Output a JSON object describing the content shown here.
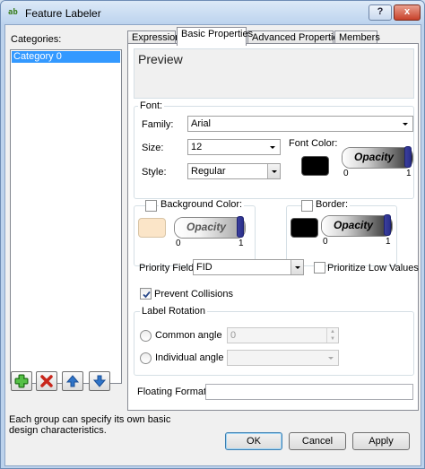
{
  "window": {
    "title": "Feature Labeler",
    "icon": "labeler-icon"
  },
  "titlebar": {
    "help_label": "?",
    "close_label": "x"
  },
  "categories": {
    "label": "Categories:",
    "items": [
      "Category 0"
    ]
  },
  "category_buttons": [
    {
      "icon": "add-icon"
    },
    {
      "icon": "delete-icon"
    },
    {
      "icon": "arrow-up-icon"
    },
    {
      "icon": "arrow-down-icon"
    }
  ],
  "tabs": [
    "Expression",
    "Basic Properties",
    "Advanced Properties",
    "Members"
  ],
  "active_tab": "Basic Properties",
  "preview": {
    "label": "Preview"
  },
  "font": {
    "group_label": "Font:",
    "family_label": "Family:",
    "family_value": "Arial",
    "size_label": "Size:",
    "size_value": "12",
    "style_label": "Style:",
    "style_value": "Regular",
    "color_label": "Font Color:",
    "color": "#000000",
    "opacity_label": "Opacity",
    "opacity_min": "0",
    "opacity_max": "1",
    "opacity_value": 1
  },
  "background": {
    "label": "Background Color:",
    "checked": false,
    "color": "#fbe5c8",
    "opacity_label": "Opacity",
    "opacity_min": "0",
    "opacity_max": "1"
  },
  "border": {
    "label": "Border:",
    "checked": false,
    "color": "#000000",
    "opacity_label": "Opacity",
    "opacity_min": "0",
    "opacity_max": "1"
  },
  "priority": {
    "label": "Priority Field",
    "value": "FID",
    "prioritize_low_label": "Prioritize Low Values",
    "prioritize_low_checked": false
  },
  "prevent_collisions": {
    "label": "Prevent Collisions",
    "checked": true
  },
  "rotation": {
    "group_label": "Label Rotation",
    "common_label": "Common angle",
    "common_value": "0",
    "individual_label": "Individual angle",
    "individual_value": ""
  },
  "floating_format": {
    "label": "Floating Format:",
    "value": ""
  },
  "info_text": "Each group can specify its own basic design characteristics.",
  "buttons": {
    "ok": "OK",
    "cancel": "Cancel",
    "apply": "Apply"
  }
}
